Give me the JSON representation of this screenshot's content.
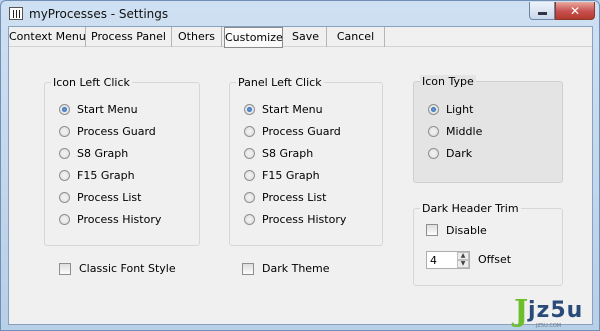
{
  "window": {
    "title": "myProcesses - Settings",
    "close_glyph": "✕"
  },
  "tabs": [
    {
      "label": "Context Menu"
    },
    {
      "label": "Process Panel"
    },
    {
      "label": "Others"
    },
    {
      "label": "Customize",
      "selected": true
    },
    {
      "label": "Save"
    },
    {
      "label": "Cancel"
    }
  ],
  "icon_left_click": {
    "title": "Icon Left Click",
    "options": [
      "Start Menu",
      "Process Guard",
      "S8 Graph",
      "F15 Graph",
      "Process List",
      "Process History"
    ],
    "selected": "Start Menu"
  },
  "panel_left_click": {
    "title": "Panel Left Click",
    "options": [
      "Start Menu",
      "Process Guard",
      "S8 Graph",
      "F15 Graph",
      "Process List",
      "Process History"
    ],
    "selected": "Start Menu"
  },
  "icon_type": {
    "title": "Icon Type",
    "options": [
      "Light",
      "Middle",
      "Dark"
    ],
    "selected": "Light"
  },
  "dark_header_trim": {
    "title": "Dark Header Trim",
    "disable_label": "Disable",
    "disable_checked": false,
    "offset_value": "4",
    "offset_label": "Offset"
  },
  "checkboxes": {
    "classic_font_style": {
      "label": "Classic Font Style",
      "checked": false
    },
    "dark_theme": {
      "label": "Dark Theme",
      "checked": false
    }
  },
  "watermark": {
    "brand": "jz5u",
    "sub": "JZ5U.COM"
  },
  "icons": {
    "app": "process-grid-icon",
    "minimize": "minimize-icon",
    "close": "close-icon",
    "spin_up": "chevron-up-icon",
    "spin_down": "chevron-down-icon"
  }
}
